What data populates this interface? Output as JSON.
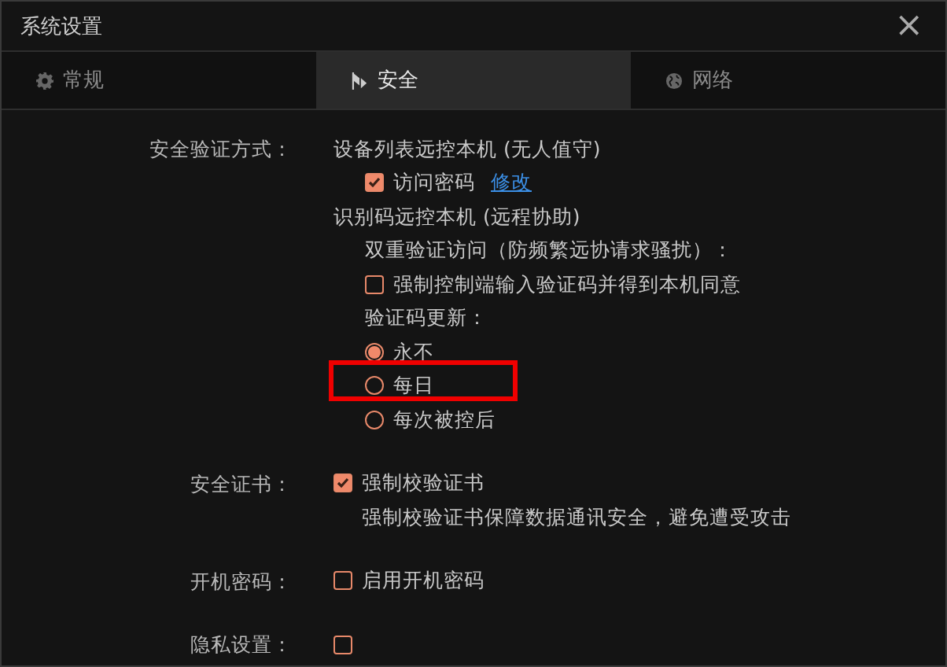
{
  "window": {
    "title": "系统设置",
    "close": "×"
  },
  "tabs": [
    {
      "label": "常规",
      "kind": "gear",
      "selected": false
    },
    {
      "label": "安全",
      "kind": "flag",
      "selected": true
    },
    {
      "label": "网络",
      "kind": "globe",
      "selected": false
    }
  ],
  "sections": [
    {
      "label": "安全验证方式：",
      "items": [
        {
          "kind": "text",
          "text": "设备列表远控本机 (无人值守)",
          "children": [
            {
              "kind": "checkbox",
              "label": "访问密码",
              "checked": true,
              "link": "修改"
            }
          ]
        },
        {
          "kind": "text",
          "text": "识别码远控本机 (远程协助)",
          "children": [
            {
              "kind": "text",
              "text": "双重验证访问（防频繁远协请求骚扰）："
            },
            {
              "kind": "checkbox",
              "label": "强制控制端输入验证码并得到本机同意",
              "checked": false
            },
            {
              "kind": "text",
              "text": "验证码更新："
            },
            {
              "kind": "radio",
              "label": "永不",
              "selected": true,
              "highlighted": false
            },
            {
              "kind": "radio",
              "label": "每日",
              "selected": false,
              "highlighted": true
            },
            {
              "kind": "radio",
              "label": "每次被控后",
              "selected": false,
              "highlighted": false
            }
          ]
        }
      ]
    },
    {
      "label": "安全证书：",
      "items": [
        {
          "kind": "checkbox",
          "label": "强制校验证书",
          "checked": true
        },
        {
          "kind": "note",
          "text": "强制校验证书保障数据通讯安全，避免遭受攻击"
        }
      ]
    },
    {
      "label": "开机密码：",
      "items": [
        {
          "kind": "checkbox",
          "label": "启用开机密码",
          "checked": false
        }
      ]
    },
    {
      "label": "隐私设置：",
      "items": [
        {
          "kind": "checkbox",
          "checked": false
        }
      ]
    }
  ]
}
